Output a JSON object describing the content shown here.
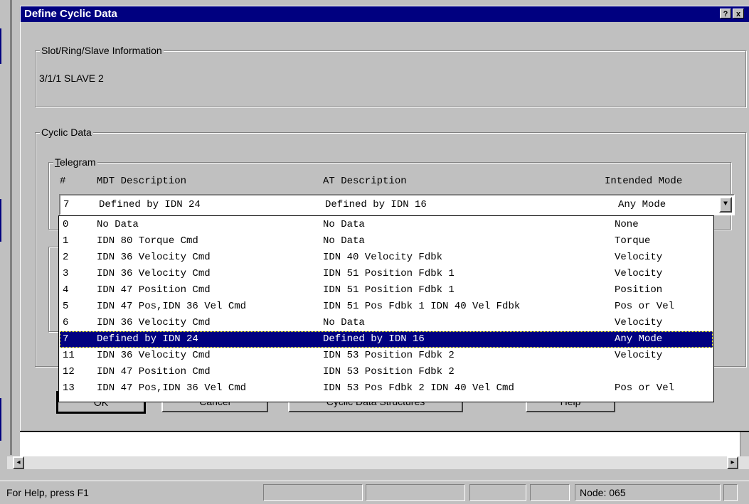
{
  "dialog": {
    "title": "Define Cyclic Data",
    "help_button": "?",
    "close_button": "x"
  },
  "slot_group": {
    "label": "Slot/Ring/Slave Information",
    "value": "3/1/1  SLAVE 2"
  },
  "cyclic_group": {
    "label": "Cyclic Data",
    "telegram_label_underlined": "T",
    "telegram_label_rest": "elegram"
  },
  "telegram": {
    "headers": {
      "num": "#",
      "mdt": "MDT Description",
      "at": "AT Description",
      "mode": "Intended Mode"
    },
    "selected": {
      "num": "7",
      "mdt": "Defined by IDN 24",
      "at": "Defined by IDN 16",
      "mode": "Any Mode"
    },
    "options": [
      {
        "num": "0",
        "mdt": "No Data",
        "at": "No Data",
        "mode": "None"
      },
      {
        "num": "1",
        "mdt": "IDN 80 Torque Cmd",
        "at": "No Data",
        "mode": "Torque"
      },
      {
        "num": "2",
        "mdt": "IDN 36 Velocity Cmd",
        "at": "IDN 40 Velocity Fdbk",
        "mode": "Velocity"
      },
      {
        "num": "3",
        "mdt": "IDN 36 Velocity Cmd",
        "at": "IDN 51 Position Fdbk 1",
        "mode": "Velocity"
      },
      {
        "num": "4",
        "mdt": "IDN 47 Position Cmd",
        "at": "IDN 51 Position Fdbk 1",
        "mode": "Position"
      },
      {
        "num": "5",
        "mdt": "IDN 47 Pos,IDN 36 Vel Cmd",
        "at": "IDN 51 Pos Fdbk 1 IDN 40 Vel Fdbk",
        "mode": "Pos or Vel"
      },
      {
        "num": "6",
        "mdt": "IDN 36 Velocity Cmd",
        "at": "No Data",
        "mode": "Velocity"
      },
      {
        "num": "7",
        "mdt": "Defined by IDN 24",
        "at": "Defined by IDN 16",
        "mode": "Any Mode"
      },
      {
        "num": "11",
        "mdt": "IDN 36 Velocity Cmd",
        "at": "IDN 53 Position Fdbk 2",
        "mode": "Velocity"
      },
      {
        "num": "12",
        "mdt": "IDN 47 Position Cmd",
        "at": "IDN 53 Position Fdbk 2",
        "mode": ""
      },
      {
        "num": "13",
        "mdt": "IDN 47 Pos,IDN 36 Vel Cmd",
        "at": "IDN 53 Pos Fdbk 2 IDN 40 Vel Cmd",
        "mode": "Pos or Vel"
      }
    ]
  },
  "buttons": {
    "ok": "OK",
    "cancel": "Cancel",
    "structures": "Cyclic Data Structures",
    "help": "Help"
  },
  "statusbar": {
    "help_text": "For Help, press F1",
    "node": "Node:  065"
  },
  "colors": {
    "title_bg": "#000080",
    "selection_bg": "#000080"
  }
}
